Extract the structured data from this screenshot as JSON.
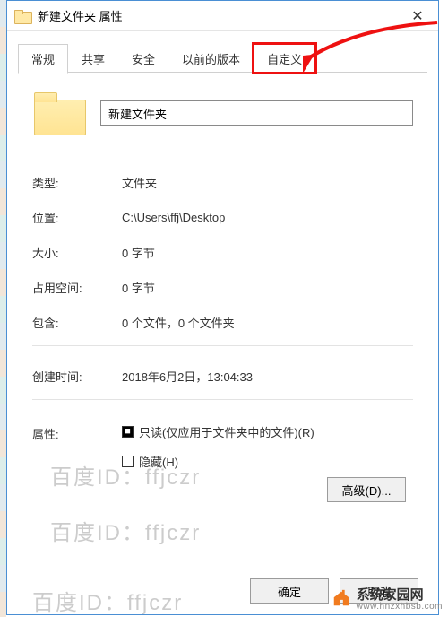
{
  "window": {
    "title": "新建文件夹 属性",
    "close_glyph": "✕"
  },
  "tabs": [
    {
      "label": "常规",
      "active": true
    },
    {
      "label": "共享"
    },
    {
      "label": "安全"
    },
    {
      "label": "以前的版本"
    },
    {
      "label": "自定义",
      "highlighted": true
    }
  ],
  "folder": {
    "name_value": "新建文件夹"
  },
  "props": {
    "type_label": "类型:",
    "type_value": "文件夹",
    "location_label": "位置:",
    "location_value": "C:\\Users\\ffj\\Desktop",
    "size_label": "大小:",
    "size_value": "0 字节",
    "ondisk_label": "占用空间:",
    "ondisk_value": "0 字节",
    "contains_label": "包含:",
    "contains_value": "0 个文件，0 个文件夹",
    "created_label": "创建时间:",
    "created_value": "2018年6月2日，13:04:33"
  },
  "attributes": {
    "label": "属性:",
    "readonly_label": "只读(仅应用于文件夹中的文件)(R)",
    "readonly_checked": true,
    "hidden_label": "隐藏(H)",
    "hidden_checked": false,
    "advanced_label": "高级(D)..."
  },
  "buttons": {
    "ok": "确定",
    "cancel": "取消"
  },
  "watermark": {
    "line1": "百度ID：ffjczr",
    "line2": "百度ID：ffjczr",
    "line3": "百度ID：ffjczr"
  },
  "brand": {
    "name": "系统家园网",
    "url": "www.hnzxhbsb.com"
  }
}
